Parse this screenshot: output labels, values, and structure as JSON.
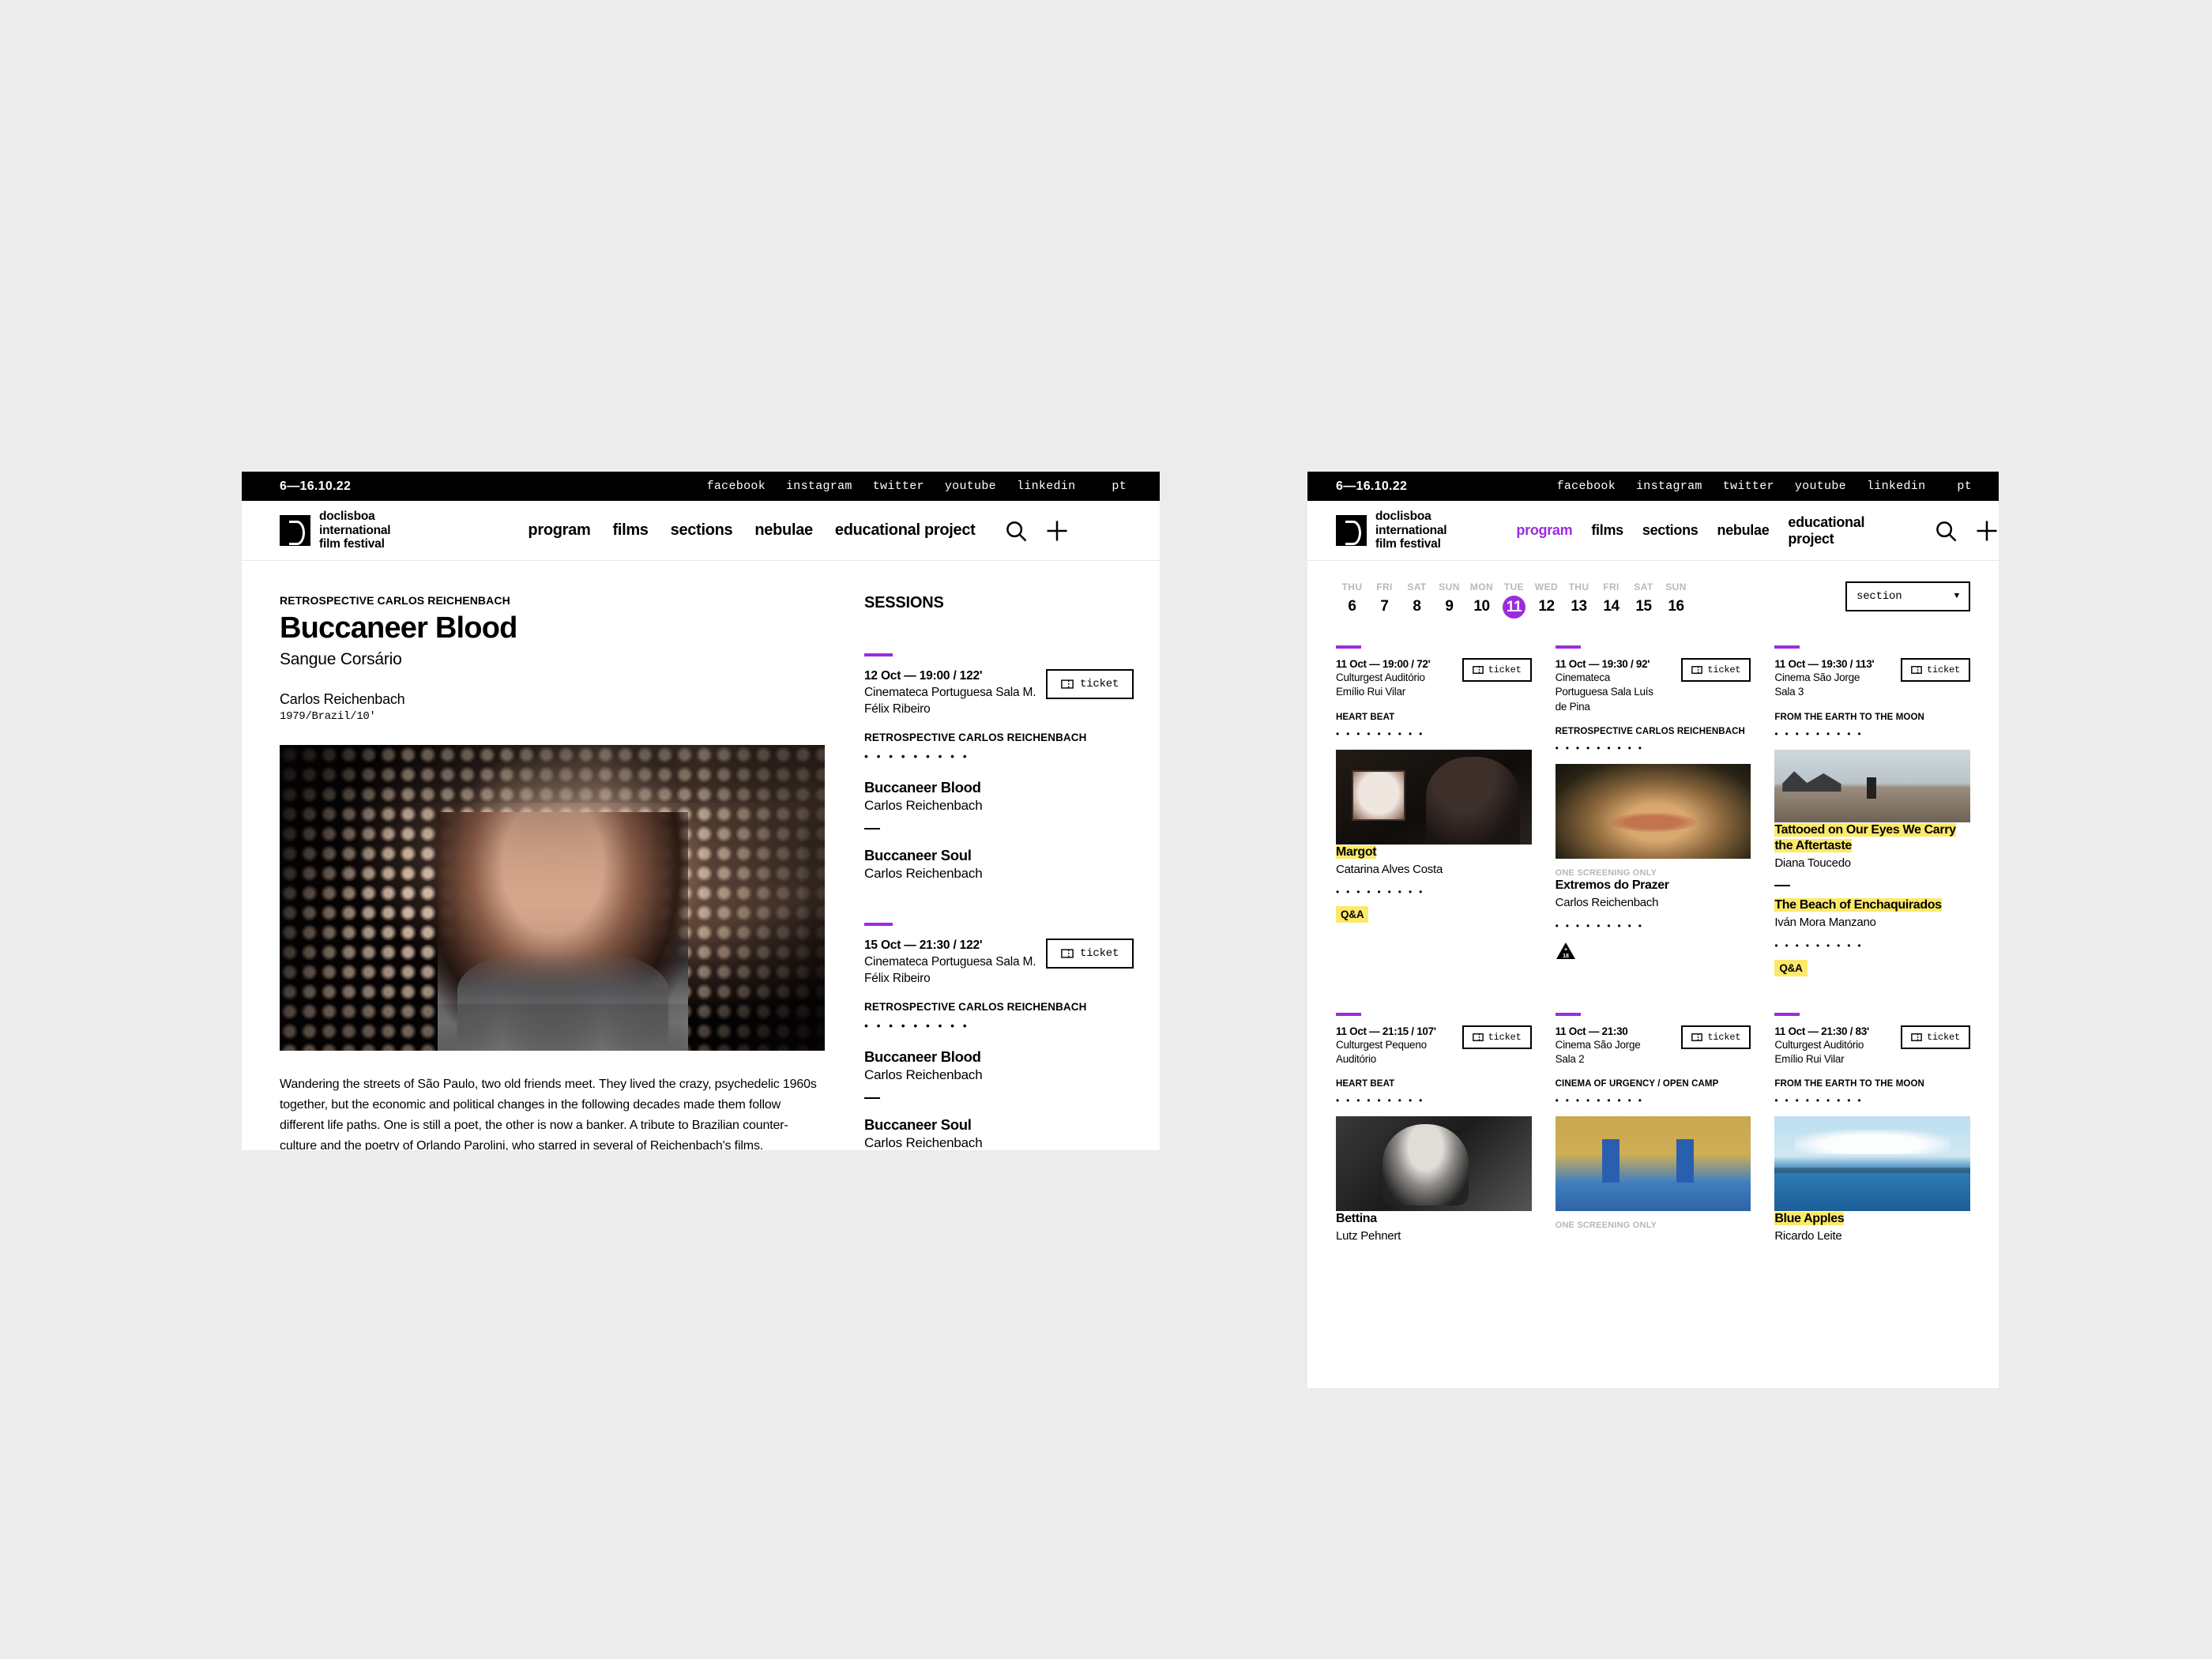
{
  "brand": {
    "line1": "doclisboa",
    "line2": "international",
    "line3": "film festival",
    "dates": "6—16.10.22"
  },
  "topbar": {
    "social": [
      "facebook",
      "instagram",
      "twitter",
      "youtube",
      "linkedin"
    ],
    "lang": "pt"
  },
  "nav": {
    "items": [
      "program",
      "films",
      "sections",
      "nebulae",
      "educational project"
    ],
    "active_on_program_window": "program",
    "search_icon": "search-icon",
    "plus_icon": "plus-icon"
  },
  "detail": {
    "eyebrow": "RETROSPECTIVE CARLOS REICHENBACH",
    "title": "Buccaneer Blood",
    "subtitle": "Sangue Corsário",
    "director": "Carlos Reichenbach",
    "meta": "1979/Brazil/10'",
    "synopsis": "Wandering the streets of São Paulo, two old friends meet. They lived the crazy, psychedelic 1960s together, but the economic and political changes in the following decades made them follow different life paths. One is still a poet, the other is now a banker. A tribute to Brazilian counter-culture and the poetry of Orlando Parolini, who starred in several of Reichenbach's films.",
    "sessions_heading": "SESSIONS",
    "ticket_label": "ticket",
    "dots": "• • • • • • • • •",
    "sessions": [
      {
        "when": "12 Oct — 19:00 / 122'",
        "where": "Cinemateca Portuguesa Sala M. Félix Ribeiro",
        "section": "RETROSPECTIVE CARLOS REICHENBACH",
        "films": [
          {
            "name": "Buccaneer Blood",
            "director": "Carlos Reichenbach"
          },
          {
            "name": "Buccaneer Soul",
            "director": "Carlos Reichenbach"
          }
        ]
      },
      {
        "when": "15 Oct — 21:30 / 122'",
        "where": "Cinemateca Portuguesa Sala M. Félix Ribeiro",
        "section": "RETROSPECTIVE CARLOS REICHENBACH",
        "films": [
          {
            "name": "Buccaneer Blood",
            "director": "Carlos Reichenbach"
          },
          {
            "name": "Buccaneer Soul",
            "director": "Carlos Reichenbach"
          }
        ]
      }
    ]
  },
  "program": {
    "ticket_label": "ticket",
    "dots": "• • • • • • • • •",
    "one_screening_only": "ONE SCREENING ONLY",
    "qa_label": "Q&A",
    "section_filter": {
      "value": "section",
      "caret": "▼"
    },
    "days": [
      {
        "dow": "THU",
        "num": "6",
        "selected": false
      },
      {
        "dow": "FRI",
        "num": "7",
        "selected": false
      },
      {
        "dow": "SAT",
        "num": "8",
        "selected": false
      },
      {
        "dow": "SUN",
        "num": "9",
        "selected": false
      },
      {
        "dow": "MON",
        "num": "10",
        "selected": false
      },
      {
        "dow": "TUE",
        "num": "11",
        "selected": true
      },
      {
        "dow": "WED",
        "num": "12",
        "selected": false
      },
      {
        "dow": "THU",
        "num": "13",
        "selected": false
      },
      {
        "dow": "FRI",
        "num": "14",
        "selected": false
      },
      {
        "dow": "SAT",
        "num": "15",
        "selected": false
      },
      {
        "dow": "SUN",
        "num": "16",
        "selected": false
      }
    ],
    "cards": [
      {
        "when": "11 Oct — 19:00 / 72'",
        "where": "Culturgest Auditório Emílio Rui Vilar",
        "section": "HEART BEAT",
        "film_name": "Margot",
        "film_dir": "Catarina Alves Costa",
        "qa": "Q&A"
      },
      {
        "when": "11 Oct — 19:30 / 92'",
        "where": "Cinemateca Portuguesa Sala Luís de Pina",
        "section": "RETROSPECTIVE CARLOS REICHENBACH",
        "badge": "ONE SCREENING ONLY",
        "film_name": "Extremos do Prazer",
        "film_dir": "Carlos Reichenbach",
        "age_rating": "+18"
      },
      {
        "when": "11 Oct — 19:30 / 113'",
        "where": "Cinema São Jorge Sala 3",
        "section": "FROM THE EARTH TO THE MOON",
        "film_name": "Tattooed on Our Eyes We Carry the Aftertaste",
        "film_dir": "Diana Toucedo",
        "film_name_2": "The Beach of Enchaquirados",
        "film_dir_2": "Iván Mora Manzano",
        "qa": "Q&A"
      },
      {
        "when": "11 Oct — 21:15 / 107'",
        "where": "Culturgest Pequeno Auditório",
        "section": "HEART BEAT",
        "film_name": "Bettina",
        "film_dir": "Lutz Pehnert"
      },
      {
        "when": "11 Oct — 21:30",
        "where": "Cinema São Jorge Sala 2",
        "section": "CINEMA OF URGENCY / OPEN CAMP",
        "badge": "ONE SCREENING ONLY"
      },
      {
        "when": "11 Oct — 21:30 / 83'",
        "where": "Culturgest Auditório Emílio Rui Vilar",
        "section": "FROM THE EARTH TO THE MOON",
        "film_name": "Blue Apples",
        "film_dir": "Ricardo Leite"
      }
    ]
  },
  "colors": {
    "accent_purple": "#9B2BE0",
    "highlight_yellow": "#FCE96A",
    "black": "#000000",
    "page_background": "#ECECEC"
  }
}
